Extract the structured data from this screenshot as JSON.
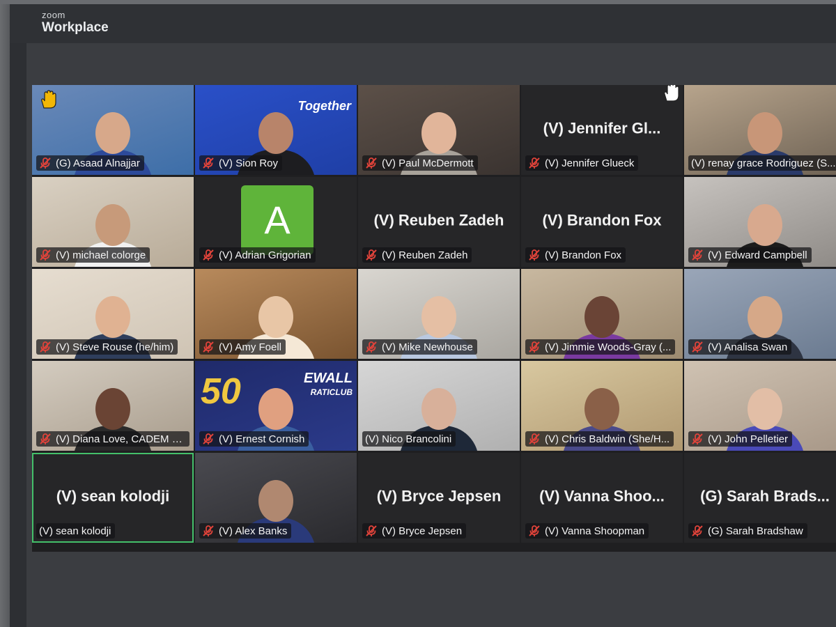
{
  "app": {
    "brand_small": "zoom",
    "brand_large": "Workplace"
  },
  "participants": [
    {
      "name": "(G) Asaad Alnajjar",
      "muted": true,
      "video": true,
      "hand": true
    },
    {
      "name": "(V) Sion Roy",
      "muted": true,
      "video": true,
      "background_text": "Together"
    },
    {
      "name": "(V) Paul McDermott",
      "muted": true,
      "video": true
    },
    {
      "name": "(V) Jennifer  Glueck",
      "display": "(V) Jennifer  Gl...",
      "muted": true,
      "video": false,
      "hand": true
    },
    {
      "name": "(V) renay grace Rodriguez (S...",
      "muted": false,
      "video": true
    },
    {
      "name": "(V) michael colorge",
      "muted": true,
      "video": true
    },
    {
      "name": "(V) Adrian Grigorian",
      "muted": true,
      "video": false,
      "avatar_letter": "A"
    },
    {
      "name": "(V) Reuben Zadeh",
      "display": "(V) Reuben Zadeh",
      "muted": true,
      "video": false
    },
    {
      "name": "(V) Brandon Fox",
      "display": "(V) Brandon Fox",
      "muted": true,
      "video": false
    },
    {
      "name": "(V) Edward Campbell",
      "muted": true,
      "video": true
    },
    {
      "name": "(V) Steve Rouse (he/him)",
      "muted": true,
      "video": true
    },
    {
      "name": "(V) Amy Foell",
      "muted": true,
      "video": true
    },
    {
      "name": "(V) Mike Newhouse",
      "muted": true,
      "video": true
    },
    {
      "name": "(V) Jimmie Woods-Gray (...",
      "muted": true,
      "video": true
    },
    {
      "name": "(V) Analisa Swan",
      "muted": true,
      "video": true
    },
    {
      "name": "(V) Diana Love, CADEM S...",
      "muted": true,
      "video": true
    },
    {
      "name": "(V) Ernest Cornish",
      "muted": true,
      "video": true,
      "background_text_1": "50",
      "background_text_2": "EWALL",
      "background_text_3": "RATICLUB"
    },
    {
      "name": "(V) Nico Brancolini",
      "muted": false,
      "video": true
    },
    {
      "name": "(V) Chris Baldwin (She/H...",
      "muted": true,
      "video": true
    },
    {
      "name": "(V) John Pelletier",
      "muted": true,
      "video": true
    },
    {
      "name": "(V) sean kolodji",
      "display": "(V) sean kolodji",
      "muted": false,
      "video": false,
      "active_speaker": true
    },
    {
      "name": "(V) Alex Banks",
      "muted": true,
      "video": true
    },
    {
      "name": "(V) Bryce Jepsen",
      "display": "(V) Bryce Jepsen",
      "muted": true,
      "video": false
    },
    {
      "name": "(V) Vanna Shoopman",
      "display": "(V) Vanna  Shoo...",
      "muted": true,
      "video": false
    },
    {
      "name": "(G) Sarah Bradshaw",
      "display": "(G)  Sarah  Brads...",
      "muted": true,
      "video": false
    }
  ],
  "colors": {
    "active_outline": "#44c06a",
    "mic_off": "#e0433a",
    "hand": "#f2b705",
    "avatar_bg": "#5fb43a"
  }
}
